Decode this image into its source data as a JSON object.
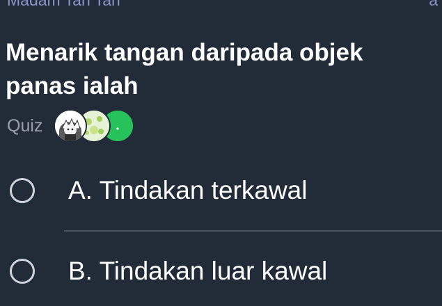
{
  "header": {
    "author": "Madam Tan Tan",
    "corner_text": "a"
  },
  "question": {
    "text": "Menarik tangan daripada objek panas ialah"
  },
  "meta": {
    "quiz_label": "Quiz",
    "avatars": [
      {
        "icon": "anime-avatar-icon",
        "color": "#ffffff"
      },
      {
        "icon": "flower-avatar-icon",
        "color": "#e6f2d6"
      },
      {
        "icon": "green-avatar-icon",
        "color": "#27c25a"
      }
    ]
  },
  "options": [
    {
      "label": "A. Tindakan terkawal",
      "selected": false
    },
    {
      "label": "B. Tindakan luar kawal",
      "selected": false
    }
  ],
  "colors": {
    "background": "#222b38",
    "author_text": "#8d95c8",
    "divider": "#4a5362"
  }
}
